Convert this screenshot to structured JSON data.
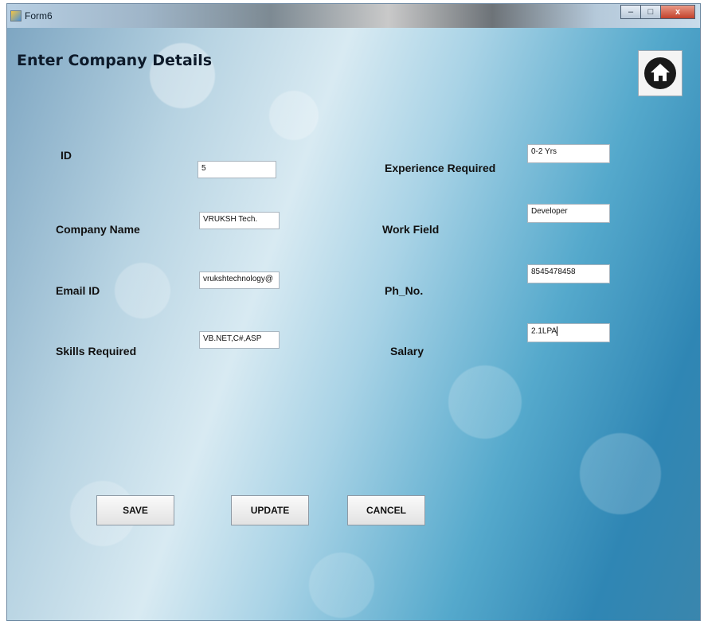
{
  "window": {
    "title": "Form6",
    "minimize": "–",
    "maximize": "□",
    "close": "x"
  },
  "form": {
    "title": "Enter Company Details",
    "home_icon": "home-icon"
  },
  "labels": {
    "id": "ID",
    "company_name": "Company Name",
    "email_id": "Email ID",
    "skills_required": "Skills Required",
    "experience_required": "Experience Required",
    "work_field": "Work Field",
    "ph_no": "Ph_No.",
    "salary": "Salary"
  },
  "fields": {
    "id": "5",
    "company_name": "VRUKSH Tech.",
    "email_id": "vrukshtechnology@",
    "skills_required": "VB.NET,C#,ASP",
    "experience_required": "0-2 Yrs",
    "work_field": "Developer",
    "ph_no": "8545478458",
    "salary": "2.1LPA"
  },
  "buttons": {
    "save": "SAVE",
    "update": "UPDATE",
    "cancel": "CANCEL"
  }
}
